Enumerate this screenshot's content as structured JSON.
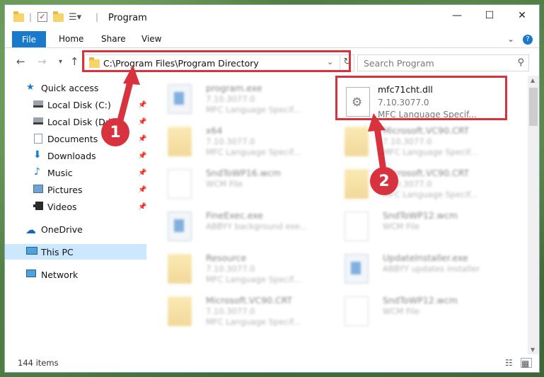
{
  "window": {
    "title": "Program"
  },
  "ribbon": {
    "tabs": [
      "File",
      "Home",
      "Share",
      "View"
    ],
    "help_icon": "?"
  },
  "nav": {
    "back_icon": "back-arrow-icon",
    "address": "C:\\Program Files\\Program Directory",
    "search_placeholder": "Search Program"
  },
  "sidebar": {
    "items": [
      {
        "label": "Quick access",
        "icon": "star-icon"
      },
      {
        "label": "Local Disk (C:)",
        "icon": "drive-icon",
        "pinned": true
      },
      {
        "label": "Local Disk (D:)",
        "icon": "drive-icon",
        "pinned": true
      },
      {
        "label": "Documents",
        "icon": "documents-icon",
        "pinned": true
      },
      {
        "label": "Downloads",
        "icon": "downloads-icon",
        "pinned": true
      },
      {
        "label": "Music",
        "icon": "music-icon",
        "pinned": true
      },
      {
        "label": "Pictures",
        "icon": "pictures-icon",
        "pinned": true
      },
      {
        "label": "Videos",
        "icon": "videos-icon",
        "pinned": true
      },
      {
        "label": "OneDrive",
        "icon": "cloud-icon"
      },
      {
        "label": "This PC",
        "icon": "computer-icon",
        "selected": true
      },
      {
        "label": "Network",
        "icon": "network-icon"
      }
    ]
  },
  "files": [
    {
      "name": "program.exe",
      "line2": "7.10.3077.0",
      "line3": "MFC Language Specif...",
      "type": "exe"
    },
    {
      "name": "x64",
      "line2": "7.10.3077.0",
      "line3": "MFC Language Specif...",
      "type": "folder"
    },
    {
      "name": "Microsoft.VC90.CRT",
      "line2": "7.10.3077.0",
      "line3": "MFC Language Specif...",
      "type": "folder"
    },
    {
      "name": "SndToWP16.wcm",
      "line2": "WCM File",
      "line3": "",
      "type": "doc"
    },
    {
      "name": "Microsoft.VC90.CRT",
      "line2": "7.10.3077.0",
      "line3": "MFC Language Specif...",
      "type": "folder"
    },
    {
      "name": "FineExec.exe",
      "line2": "ABBYY background exe...",
      "line3": "",
      "type": "exe"
    },
    {
      "name": "SndToWP12.wcm",
      "line2": "WCM File",
      "line3": "",
      "type": "doc"
    },
    {
      "name": "Resource",
      "line2": "7.10.3077.0",
      "line3": "MFC Language Specif...",
      "type": "folder"
    },
    {
      "name": "UpdateInstaller.exe",
      "line2": "ABBYY updates installer",
      "line3": "",
      "type": "exe"
    },
    {
      "name": "Microsoft.VC90.CRT",
      "line2": "7.10.3077.0",
      "line3": "MFC Language Specif...",
      "type": "folder"
    },
    {
      "name": "SndToWP12.wcm",
      "line2": "WCM File",
      "line3": "",
      "type": "doc"
    }
  ],
  "highlighted_file": {
    "name": "mfc71cht.dll",
    "version": "7.10.3077.0",
    "description": "MFC Language Specif..."
  },
  "status": {
    "count": "144 items"
  },
  "annotations": {
    "step1": "1",
    "step2": "2",
    "color": "#d9323f"
  }
}
